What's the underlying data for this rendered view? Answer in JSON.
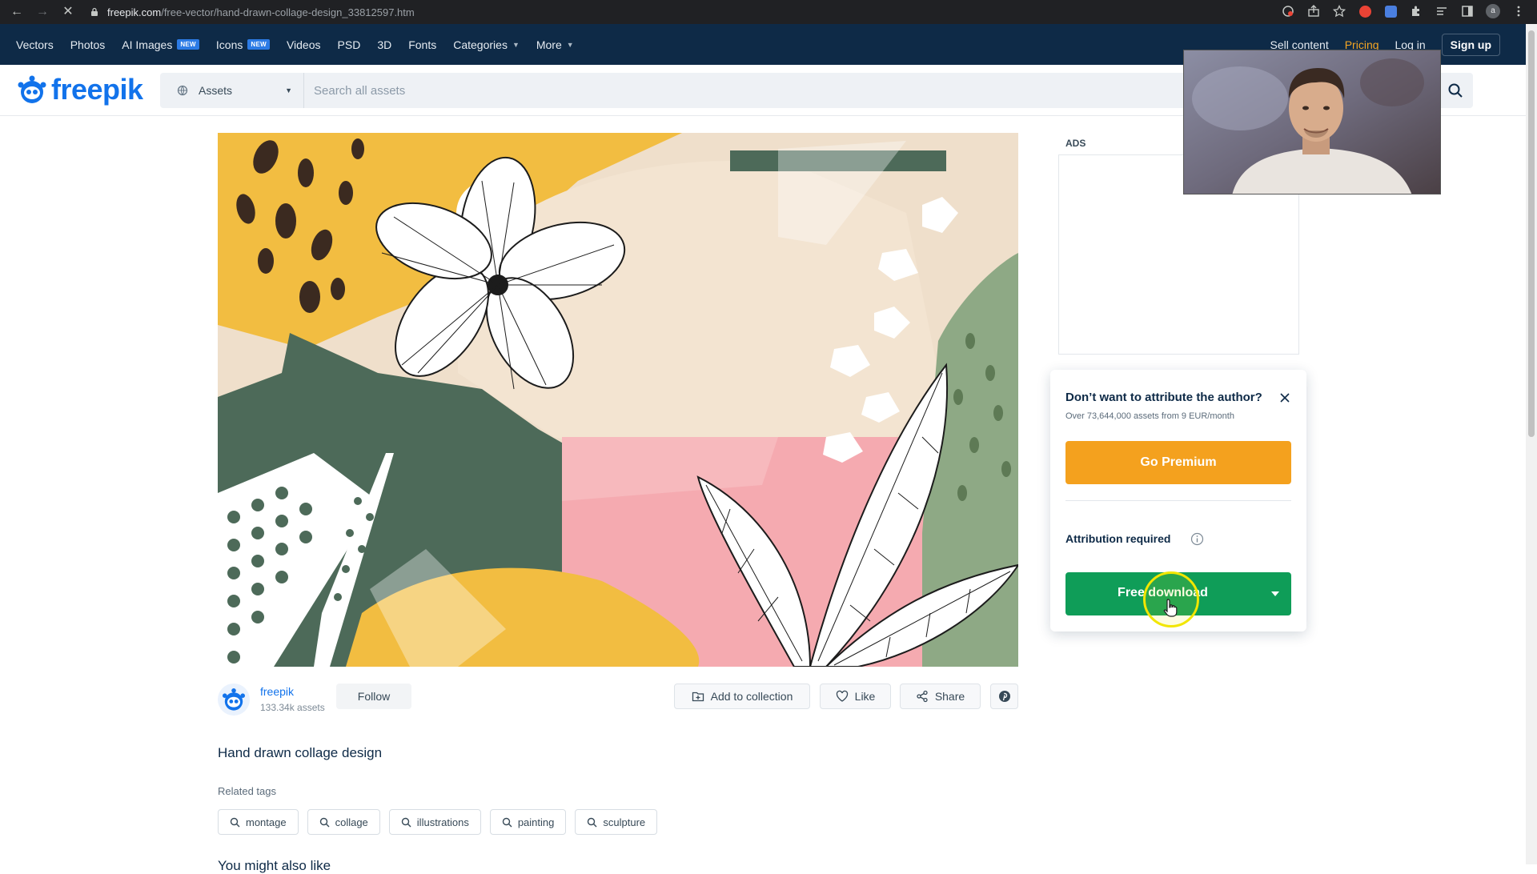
{
  "browser": {
    "url_domain": "freepik.com",
    "url_path": "/free-vector/hand-drawn-collage-design_33812597.htm",
    "profile_initial": "a"
  },
  "nav": {
    "items": [
      {
        "label": "Vectors",
        "badge": ""
      },
      {
        "label": "Photos",
        "badge": ""
      },
      {
        "label": "AI Images",
        "badge": "NEW"
      },
      {
        "label": "Icons",
        "badge": "NEW"
      },
      {
        "label": "Videos",
        "badge": ""
      },
      {
        "label": "PSD",
        "badge": ""
      },
      {
        "label": "3D",
        "badge": ""
      },
      {
        "label": "Fonts",
        "badge": ""
      }
    ],
    "categories": "Categories",
    "more": "More",
    "sell": "Sell content",
    "pricing": "Pricing",
    "login": "Log in",
    "signup": "Sign up"
  },
  "header": {
    "logo": "freepik",
    "asset_filter": "Assets",
    "search_placeholder": "Search all assets"
  },
  "asset": {
    "title": "Hand drawn collage design",
    "author": "freepik",
    "author_assets": "133.34k assets",
    "follow": "Follow",
    "add_to_collection": "Add to collection",
    "like": "Like",
    "share": "Share",
    "related_tags_label": "Related tags",
    "tags": [
      "montage",
      "collage",
      "illustrations",
      "painting",
      "sculpture"
    ],
    "next_section_partial": "You might also like"
  },
  "ads": {
    "label": "ADS"
  },
  "popup": {
    "title": "Don’t want to attribute the author?",
    "subtitle": "Over 73,644,000 assets from 9 EUR/month",
    "premium": "Go Premium",
    "attribution": "Attribution required",
    "download": "Free download"
  },
  "colors": {
    "nav_bg": "#0e2a47",
    "brand_blue": "#1273eb",
    "premium_orange": "#f4a11e",
    "download_green": "#0f9d58",
    "pricing_orange": "#f5a623"
  }
}
